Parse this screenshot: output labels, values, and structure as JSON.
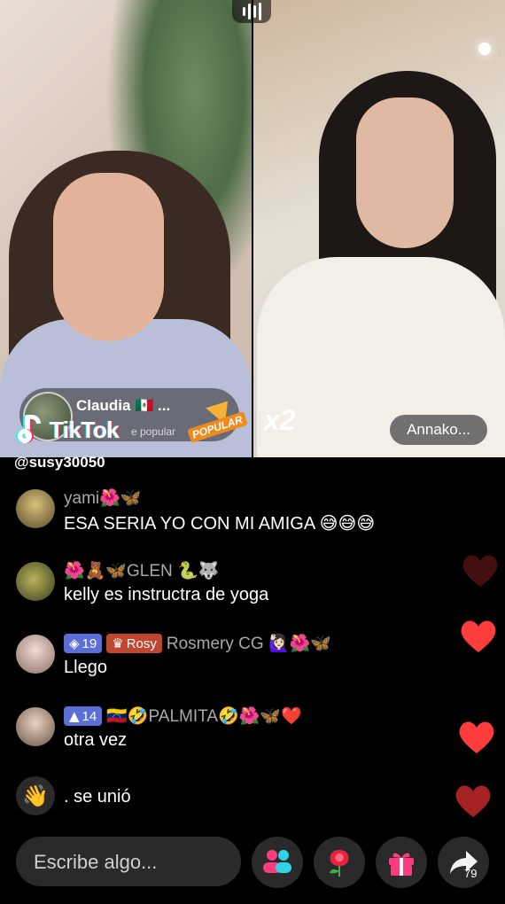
{
  "host": {
    "name": "Claudia 🇲🇽 ...",
    "subtitle": "e popular",
    "badge": "POPULAR"
  },
  "guest": {
    "name": "Annako...",
    "multiplier": "x2"
  },
  "branding": {
    "logo_text": "TikTok",
    "watermark": "@susy30050"
  },
  "comments": [
    {
      "username": "yami🌺🦋",
      "message": "ESA SERIA YO CON MI AMIGA 😅😅😅"
    },
    {
      "username": "🌺🧸🦋GLEN 🐍🐺",
      "message": "kelly es instructra de yoga"
    },
    {
      "badge_level": "19",
      "badge_fan": "Rosy",
      "username": "Rosmery CG 🙋🏻‍♀️🌺🦋",
      "message": "Llego"
    },
    {
      "badge_level": "14",
      "username": "🇻🇪🤣PALMITA🤣🌺🦋❤️",
      "message": "otra vez"
    },
    {
      "message": ". se unió"
    }
  ],
  "composer": {
    "placeholder": "Escribe algo..."
  },
  "share_count": "79",
  "colors": {
    "heart": "#fe3c3c",
    "heart_dim": "#7a1c1c",
    "level_badge": "#5b6fd8",
    "fan_badge": "#c0472f",
    "input_bg": "#2a2a2a"
  }
}
